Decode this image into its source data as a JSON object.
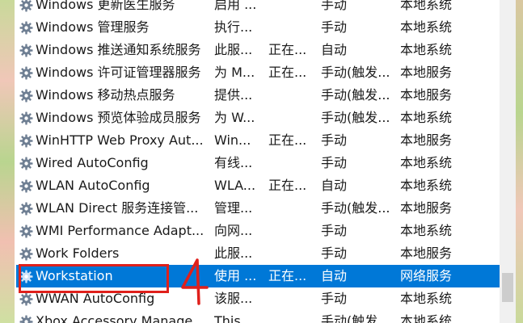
{
  "services": [
    {
      "name": "Windows 更新医生服务",
      "description": "启用 ...",
      "status": "",
      "startup": "手动",
      "logon": "本地系统"
    },
    {
      "name": "Windows 管理服务",
      "description": "执行...",
      "status": "",
      "startup": "手动",
      "logon": "本地系统"
    },
    {
      "name": "Windows 推送通知系统服务",
      "description": "此服...",
      "status": "正在...",
      "startup": "自动",
      "logon": "本地系统"
    },
    {
      "name": "Windows 许可证管理器服务",
      "description": "为 M...",
      "status": "正在...",
      "startup": "手动(触发...",
      "logon": "本地服务"
    },
    {
      "name": "Windows 移动热点服务",
      "description": "提供...",
      "status": "",
      "startup": "手动(触发...",
      "logon": "本地服务"
    },
    {
      "name": "Windows 预览体验成员服务",
      "description": "为 W...",
      "status": "",
      "startup": "手动(触发...",
      "logon": "本地系统"
    },
    {
      "name": "WinHTTP Web Proxy Aut...",
      "description": "Win...",
      "status": "正在...",
      "startup": "手动",
      "logon": "本地服务"
    },
    {
      "name": "Wired AutoConfig",
      "description": "有线...",
      "status": "",
      "startup": "手动",
      "logon": "本地系统"
    },
    {
      "name": "WLAN AutoConfig",
      "description": "WLA...",
      "status": "正在...",
      "startup": "自动",
      "logon": "本地系统"
    },
    {
      "name": "WLAN Direct 服务连接管...",
      "description": "管理...",
      "status": "",
      "startup": "手动(触发...",
      "logon": "本地服务"
    },
    {
      "name": "WMI Performance Adapt...",
      "description": "向网...",
      "status": "",
      "startup": "手动",
      "logon": "本地系统"
    },
    {
      "name": "Work Folders",
      "description": "此服...",
      "status": "",
      "startup": "手动",
      "logon": "本地服务"
    },
    {
      "name": "Workstation",
      "description": "使用 ...",
      "status": "正在...",
      "startup": "自动",
      "logon": "网络服务"
    },
    {
      "name": "WWAN AutoConfig",
      "description": "该服...",
      "status": "",
      "startup": "手动",
      "logon": "本地系统"
    },
    {
      "name": "Xbox Accessory Manage...",
      "description": "This...",
      "status": "",
      "startup": "手动(触发...",
      "logon": "本地系统"
    }
  ],
  "selected_index": 12,
  "annotation": {
    "number": "4",
    "color": "#e0201b"
  },
  "colors": {
    "selection": "#0078d7",
    "annotation_red": "#e0201b"
  },
  "icons": {
    "service": "gear-icon"
  }
}
